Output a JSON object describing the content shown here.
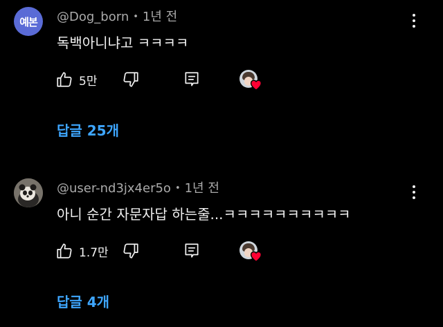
{
  "comments": [
    {
      "avatar_text": "예본",
      "author": "@Dog_born",
      "time": "1년 전",
      "text": "독백아니냐고 ㅋㅋㅋㅋ",
      "likes": "5만",
      "replies_label": "답글 25개"
    },
    {
      "avatar_text": "",
      "author": "@user-nd3jx4er5o",
      "time": "1년 전",
      "text": "아니 순간 자문자답 하는줄...ㅋㅋㅋㅋㅋㅋㅋㅋㅋㅋ",
      "likes": "1.7만",
      "replies_label": "답글 4개"
    }
  ],
  "separator": "•",
  "colors": {
    "background": "#000000",
    "text": "#f1f1f1",
    "meta": "#aaaaaa",
    "link": "#3ea6ff",
    "heart": "#ff0033",
    "avatar_accent": "#5a6bd6"
  },
  "icons": [
    "thumb-up-icon",
    "thumb-down-icon",
    "reply-icon",
    "more-vert-icon",
    "heart-icon"
  ]
}
